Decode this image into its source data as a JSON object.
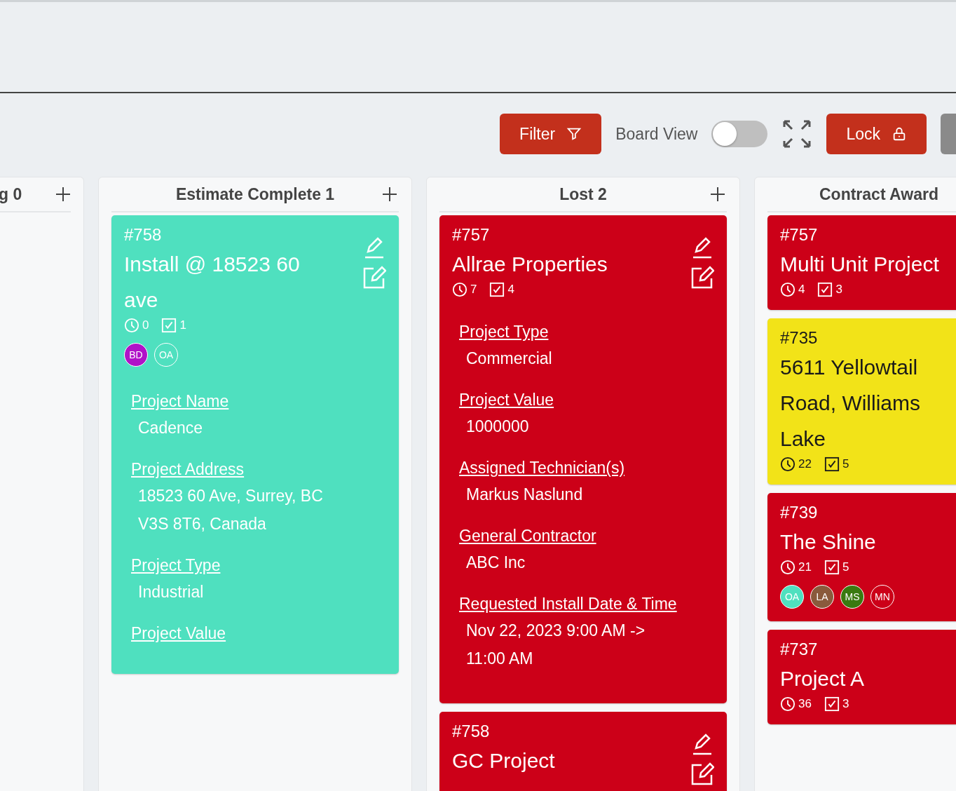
{
  "toolbar": {
    "filter_label": "Filter",
    "board_view_label": "Board View",
    "board_view_on": false,
    "lock_label": "Lock"
  },
  "columns": [
    {
      "title": "g 0"
    },
    {
      "title": "Estimate Complete 1",
      "cards": [
        {
          "id": "#758",
          "title": "Install @ 18523 60 ave",
          "color": "#4fe0bf",
          "time": "0",
          "tasks": "1",
          "edit_icons": true,
          "avatars": [
            {
              "initials": "BD",
              "color": "#b012c8"
            },
            {
              "initials": "OA"
            }
          ],
          "fields": [
            {
              "label": "Project Name",
              "value": "Cadence"
            },
            {
              "label": "Project Address",
              "value": "18523 60 Ave, Surrey, BC V3S 8T6, Canada"
            },
            {
              "label": "Project Type",
              "value": "Industrial"
            },
            {
              "label": "Project Value"
            }
          ]
        }
      ]
    },
    {
      "title": "Lost 2",
      "cards": [
        {
          "id": "#757",
          "title": "Allrae Properties",
          "color": "#cc0018",
          "time": "7",
          "tasks": "4",
          "edit_icons": true,
          "fields": [
            {
              "label": "Project Type",
              "value": "Commercial"
            },
            {
              "label": "Project Value",
              "value": "1000000"
            },
            {
              "label": "Assigned Technician(s)",
              "value": "Markus Naslund"
            },
            {
              "label": "General Contractor",
              "value": "ABC Inc"
            },
            {
              "label": "Requested Install Date & Time",
              "value": "Nov 22, 2023 9:00 AM -> 11:00 AM"
            }
          ]
        },
        {
          "id": "#758",
          "title": "GC Project",
          "color": "#cc0018",
          "edit_icons": true
        }
      ]
    },
    {
      "title": "Contract Award",
      "cards": [
        {
          "id": "#757",
          "title": "Multi Unit Project",
          "color": "#cc0018",
          "time": "4",
          "tasks": "3",
          "edit_icons": false
        },
        {
          "id": "#735",
          "title": "5611 Yellowtail Road, Williams Lake",
          "color": "#f2e318",
          "time": "22",
          "tasks": "5",
          "edit_icons": false
        },
        {
          "id": "#739",
          "title": "The Shine",
          "color": "#cc0018",
          "time": "21",
          "tasks": "5",
          "edit_icons": false,
          "avatars": [
            {
              "initials": "OA",
              "color": "#4fe0bf"
            },
            {
              "initials": "LA",
              "color": "#8a5a3c"
            },
            {
              "initials": "MS",
              "color": "#3a7a10"
            },
            {
              "initials": "MN"
            }
          ]
        },
        {
          "id": "#737",
          "title": "Project A",
          "color": "#cc0018",
          "time": "36",
          "tasks": "3",
          "edit_icons": false
        }
      ]
    }
  ]
}
